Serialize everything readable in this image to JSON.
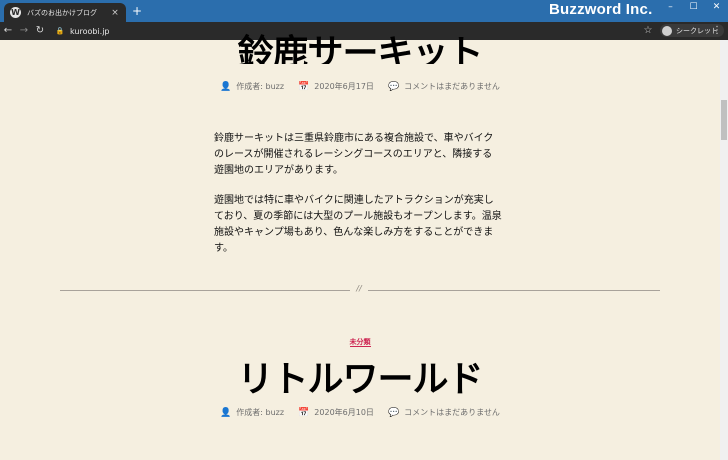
{
  "browser": {
    "tab_title": "バズのお出かけブログ",
    "tab_close": "×",
    "new_tab": "+",
    "brand": "Buzzword Inc.",
    "window_controls": {
      "minimize": "–",
      "maximize": "☐",
      "close": "✕"
    },
    "nav": {
      "back": "←",
      "forward": "→",
      "reload": "↻"
    },
    "url": "kuroobi.jp",
    "incognito_label": "シークレット"
  },
  "posts": [
    {
      "title": "鈴鹿サーキット",
      "meta": {
        "author": "作成者: buzz",
        "date": "2020年6月17日",
        "comments": "コメントはまだありません"
      },
      "paragraphs": [
        "鈴鹿サーキットは三重県鈴鹿市にある複合施設で、車やバイクのレースが開催されるレーシングコースのエリアと、隣接する遊園地のエリアがあります。",
        "遊園地では特に車やバイクに関連したアトラクションが充実しており、夏の季節には大型のプール施設もオープンします。温泉施設やキャンプ場もあり、色んな楽しみ方をすることができます。"
      ]
    },
    {
      "category": "未分類",
      "title": "リトルワールド",
      "meta": {
        "author": "作成者: buzz",
        "date": "2020年6月10日",
        "comments": "コメントはまだありません"
      }
    }
  ],
  "separator_mark": "//",
  "icons": {
    "author": "user-icon",
    "date": "calendar-icon",
    "comments": "comment-icon"
  }
}
